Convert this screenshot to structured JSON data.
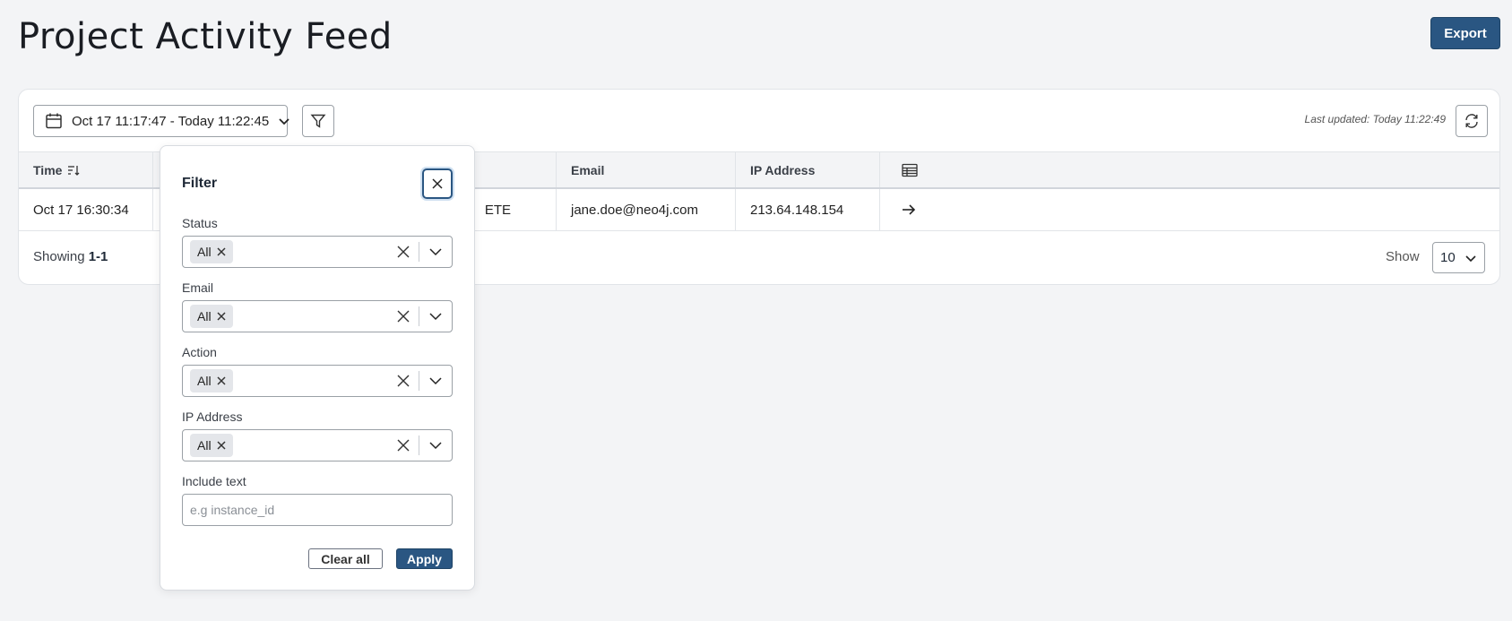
{
  "header": {
    "title": "Project Activity Feed",
    "export_label": "Export"
  },
  "toolbar": {
    "date_range": "Oct 17 11:17:47 - Today 11:22:45",
    "last_updated": "Last updated: Today 11:22:49"
  },
  "table": {
    "columns": [
      "Time",
      "",
      "",
      "Email",
      "IP Address"
    ],
    "rows": [
      {
        "time": "Oct 17 16:30:34",
        "user": "",
        "action": "ETE",
        "email": "jane.doe@neo4j.com",
        "ip": "213.64.148.154"
      }
    ]
  },
  "footer": {
    "showing_prefix": "Showing",
    "showing_range": "1-1",
    "show_label": "Show",
    "page_size": "10"
  },
  "filter": {
    "title": "Filter",
    "fields": [
      {
        "label": "Status",
        "chip": "All"
      },
      {
        "label": "Email",
        "chip": "All"
      },
      {
        "label": "Action",
        "chip": "All"
      },
      {
        "label": "IP Address",
        "chip": "All"
      }
    ],
    "include_text_label": "Include text",
    "include_text_placeholder": "e.g instance_id",
    "clear_label": "Clear all",
    "apply_label": "Apply"
  },
  "colors": {
    "primary": "#2a5682",
    "background": "#f3f4f6"
  }
}
